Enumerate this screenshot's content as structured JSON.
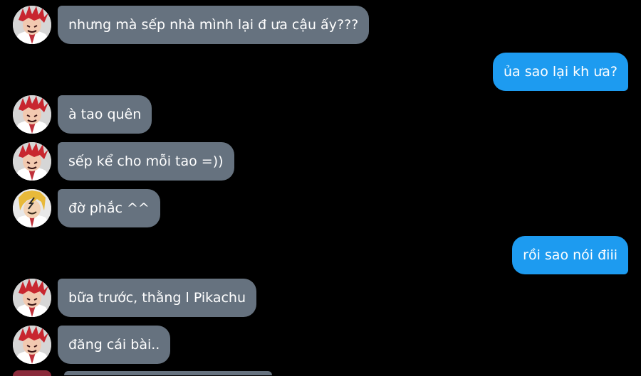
{
  "chat": {
    "messages": [
      {
        "sender": "kirishima",
        "direction": "in",
        "avatar": "red-spiky-hair-avatar",
        "text": "nhưng mà sếp nhà mình lại đ ưa cậu ấy???"
      },
      {
        "sender": "me",
        "direction": "out",
        "text": "ủa sao lại kh ưa?"
      },
      {
        "sender": "kirishima",
        "direction": "in",
        "avatar": "red-spiky-hair-avatar",
        "text": "à tao quên"
      },
      {
        "sender": "kirishima",
        "direction": "in",
        "avatar": "red-spiky-hair-avatar",
        "text": "sếp kể cho mỗi tao =))"
      },
      {
        "sender": "kaminari",
        "direction": "in",
        "avatar": "blonde-hair-avatar",
        "text": "đờ phắc ^^"
      },
      {
        "sender": "me",
        "direction": "out",
        "text": "rồi sao nói điii"
      },
      {
        "sender": "kirishima",
        "direction": "in",
        "avatar": "red-spiky-hair-avatar",
        "text": "bữa trước, thằng l Pikachu"
      },
      {
        "sender": "kirishima",
        "direction": "in",
        "avatar": "red-spiky-hair-avatar",
        "text": "đăng cái bài.."
      }
    ]
  },
  "colors": {
    "background": "#000000",
    "incoming_bubble": "#66727f",
    "outgoing_bubble": "#1d9bf0",
    "text": "#ffffff"
  }
}
